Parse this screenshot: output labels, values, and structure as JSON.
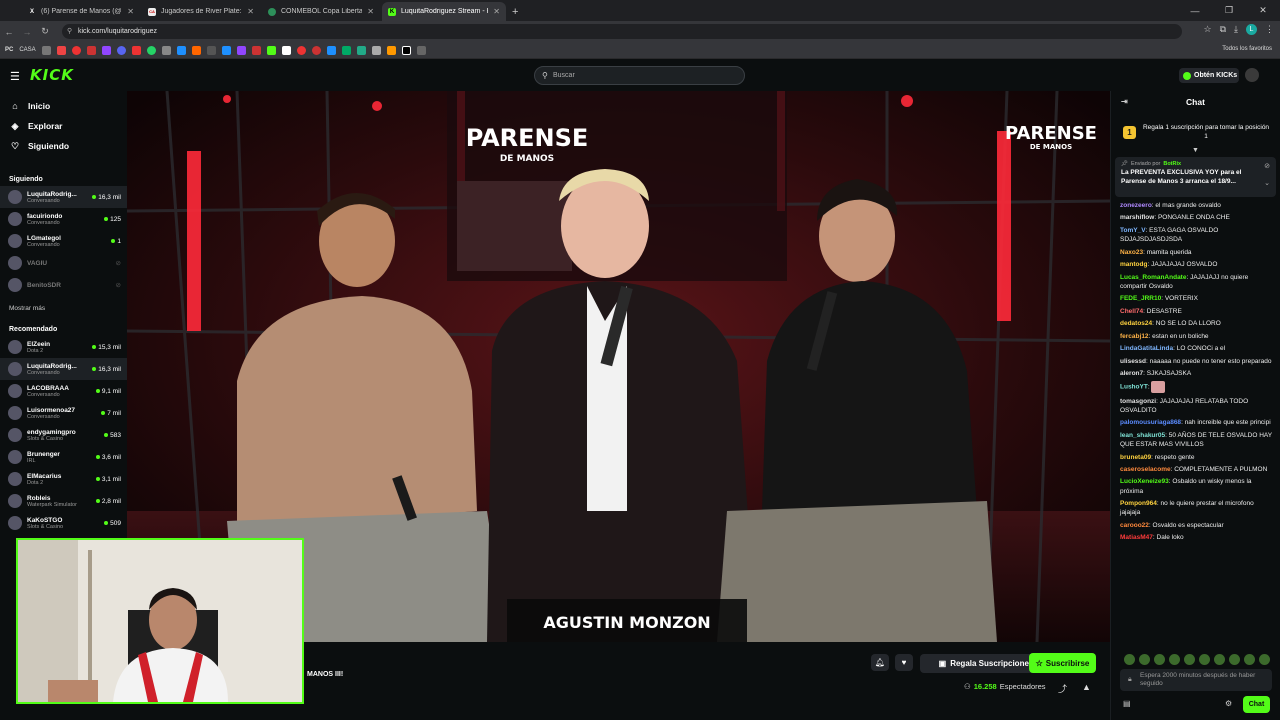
{
  "browser": {
    "tabs": [
      {
        "title": "(6) Parense de Manos (@Parense",
        "favicon": "X",
        "active": false
      },
      {
        "title": "Jugadores de River Plate: Plantel",
        "favicon": "CARP",
        "active": false
      },
      {
        "title": "CONMEBOL Copa Libertadores",
        "favicon": "globe",
        "active": false
      },
      {
        "title": "LuquitaRodriguez Stream - Kick",
        "favicon": "K",
        "active": true
      }
    ],
    "url": "kick.com/luquitarodriguez",
    "bookmarks_first": "CASA",
    "all_favorites": "Todos los favoritos"
  },
  "kick": {
    "logo": "KICK",
    "search_placeholder": "Buscar",
    "get_kicks": "Obtén KICKs"
  },
  "sidebar": {
    "nav": [
      {
        "label": "Inicio",
        "icon": "home-icon"
      },
      {
        "label": "Explorar",
        "icon": "compass-icon"
      },
      {
        "label": "Siguiendo",
        "icon": "heart-icon"
      }
    ],
    "following_title": "Siguiendo",
    "following": [
      {
        "name": "LuquitaRodrig...",
        "category": "Conversando",
        "viewers": "16,3 mil",
        "live": true
      },
      {
        "name": "facuiriondo",
        "category": "Conversando",
        "viewers": "125",
        "live": true
      },
      {
        "name": "LGmategol",
        "category": "Conversando",
        "viewers": "1",
        "live": true
      },
      {
        "name": "VAGIU",
        "category": "",
        "viewers": "",
        "live": false
      },
      {
        "name": "BenitoSDR",
        "category": "",
        "viewers": "",
        "live": false
      }
    ],
    "show_more": "Mostrar más",
    "recommended_title": "Recomendado",
    "recommended": [
      {
        "name": "ElZeein",
        "category": "Dota 2",
        "viewers": "15,3 mil"
      },
      {
        "name": "LuquitaRodrig...",
        "category": "Conversando",
        "viewers": "16,3 mil"
      },
      {
        "name": "LACOBRAAA",
        "category": "Conversando",
        "viewers": "9,1 mil"
      },
      {
        "name": "Luisormenoa27",
        "category": "Conversando",
        "viewers": "7 mil"
      },
      {
        "name": "endygamingpro",
        "category": "Slots & Casino",
        "viewers": "583"
      },
      {
        "name": "Brunenger",
        "category": "IRL",
        "viewers": "3,6 mil"
      },
      {
        "name": "ElMacarius",
        "category": "Dota 2",
        "viewers": "3,1 mil"
      },
      {
        "name": "Robleis",
        "category": "Waterpark Simulator",
        "viewers": "2,8 mil"
      },
      {
        "name": "KaKoSTGO",
        "category": "Slots & Casino",
        "viewers": "509"
      }
    ]
  },
  "video": {
    "overlay_title_1": "PARENSE",
    "overlay_title_2": "DE MANOS",
    "lower_third": "AGUSTIN MONZON"
  },
  "stream_info": {
    "title_fragment": "MANOS III!",
    "gift_label": "Regala Suscripciones",
    "subscribe_label": "Suscribirse",
    "viewers_count": "16.258",
    "viewers_label": "Espectadores"
  },
  "chat": {
    "title": "Chat",
    "gift_banner": "Regala 1 suscripción para tomar la posición 1",
    "pinned_by_label": "Enviado por",
    "pinned_by_user": "BotRix",
    "pinned_text": "La PREVENTA EXCLUSIVA YOY para el Parense de Manos 3 arranca el 18/9...",
    "messages": [
      {
        "user": "zonezeero",
        "color": "#b089ff",
        "text": "el mas grande osvaldo"
      },
      {
        "user": "marshiflow",
        "color": "#e0e0e0",
        "text": "PONGANLE ONDA CHE"
      },
      {
        "user": "TomY_V",
        "color": "#7fb7ff",
        "text": "ESTA GAGA OSVALDO SDJAJSDJASDJSDA"
      },
      {
        "user": "Naxo23",
        "color": "#ffb347",
        "text": "mamita querida"
      },
      {
        "user": "mantodg",
        "color": "#ffd23f",
        "text": "JAJAJAJAJ OSVALDO"
      },
      {
        "user": "Lucas_RomanAndate",
        "color": "#53fc18",
        "text": "JAJAJAJJ no quiere compartir Osvaldo"
      },
      {
        "user": "FEDE_JRR10",
        "color": "#53fc18",
        "text": "VORTERIX"
      },
      {
        "user": "Chell74",
        "color": "#ff6b6b",
        "text": "DESASTRE"
      },
      {
        "user": "dedatos24",
        "color": "#ffd23f",
        "text": "NO SE LO DA LLORO"
      },
      {
        "user": "fercabj12",
        "color": "#ffb347",
        "text": "estan en un boliche"
      },
      {
        "user": "LindaGatitaLinda",
        "color": "#7fb7ff",
        "text": "LO CONOCi a el"
      },
      {
        "user": "ulisessd",
        "color": "#e0e0e0",
        "text": "naaaaa no puede no tener esto preparado"
      },
      {
        "user": "aleron7",
        "color": "#e0e0e0",
        "text": "SJKAJSAJSKA"
      },
      {
        "user": "LushoYT",
        "color": "#7fe3d6",
        "text": ""
      },
      {
        "user": "tomasgonzi",
        "color": "#e0e0e0",
        "text": "JAJAJAJAJ RELATABA TODO OSVALDITO"
      },
      {
        "user": "palomousuriaga868",
        "color": "#5b8cff",
        "text": "nah increible que este principi"
      },
      {
        "user": "lean_shakur05",
        "color": "#7fe3d6",
        "text": "50 AÑOS DE TELE OSVALDO HAY QUE ESTAR MAS VIVILLOS"
      },
      {
        "user": "bruneta09",
        "color": "#ffd23f",
        "text": "respeto gente"
      },
      {
        "user": "caseroselacome",
        "color": "#ff8a3d",
        "text": "COMPLETAMENTE A PULMON"
      },
      {
        "user": "LucioXeneize93",
        "color": "#53fc18",
        "text": "Osbaldo un wisky menos la próxima"
      },
      {
        "user": "Pompon964",
        "color": "#ffd23f",
        "text": "no le quiere prestar el microfono jajajaja"
      },
      {
        "user": "carooo22",
        "color": "#ff8a3d",
        "text": "Osvaldo es espectacular"
      },
      {
        "user": "MatiasM47",
        "color": "#ff3b3b",
        "text": "Dale loko"
      }
    ],
    "input_placeholder": "Espera 2000 minutos después de haber seguido",
    "send_label": "Chat"
  },
  "colors": {
    "brand": "#53fc18",
    "background": "#0b0e0f"
  }
}
